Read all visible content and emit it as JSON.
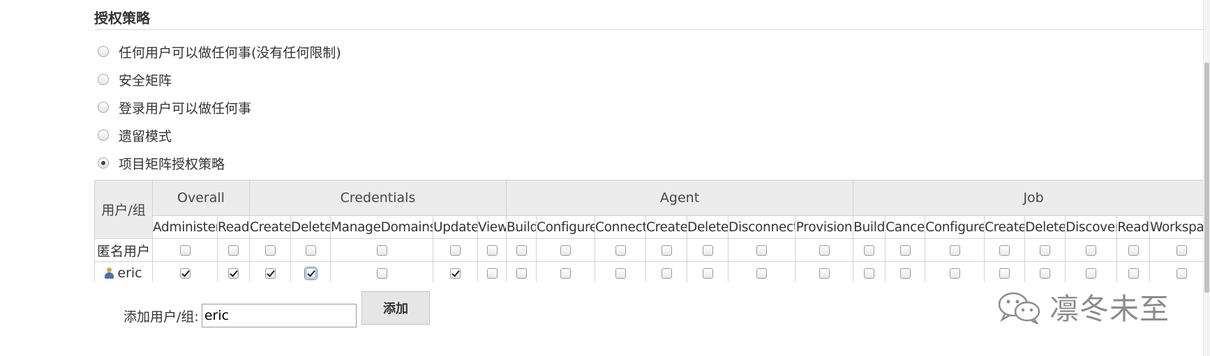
{
  "section": {
    "title": "授权策略"
  },
  "strategies": [
    {
      "label": "任何用户可以做任何事(没有任何限制)",
      "selected": false
    },
    {
      "label": "安全矩阵",
      "selected": false
    },
    {
      "label": "登录用户可以做任何事",
      "selected": false
    },
    {
      "label": "遗留模式",
      "selected": false
    },
    {
      "label": "项目矩阵授权策略",
      "selected": true
    }
  ],
  "matrix": {
    "user_header": "用户/组",
    "groups": [
      {
        "name": "Overall",
        "permissions": [
          "Administer",
          "Read"
        ]
      },
      {
        "name": "Credentials",
        "permissions": [
          "Create",
          "Delete",
          "ManageDomains",
          "Update",
          "View"
        ]
      },
      {
        "name": "Agent",
        "permissions": [
          "Build",
          "Configure",
          "Connect",
          "Create",
          "Delete",
          "Disconnect",
          "Provision"
        ]
      },
      {
        "name": "Job",
        "permissions": [
          "Build",
          "Cancel",
          "Configure",
          "Create",
          "Delete",
          "Discover",
          "Read",
          "Workspace"
        ]
      }
    ],
    "rows": [
      {
        "name": "匿名用户",
        "has_icon": false,
        "checked": [
          false,
          false,
          false,
          false,
          false,
          false,
          false,
          false,
          false,
          false,
          false,
          false,
          false,
          false,
          false,
          false,
          false,
          false,
          false,
          false,
          false,
          false
        ]
      },
      {
        "name": "eric",
        "has_icon": true,
        "checked": [
          true,
          true,
          true,
          true,
          false,
          true,
          false,
          false,
          false,
          false,
          false,
          false,
          false,
          false,
          false,
          false,
          false,
          false,
          false,
          false,
          false,
          false
        ],
        "focused_index": 3
      }
    ]
  },
  "add_user": {
    "label": "添加用户/组:",
    "value": "eric",
    "button_label": "添加"
  },
  "watermark": {
    "text": "凛冬未至",
    "icon": "wechat-icon"
  }
}
